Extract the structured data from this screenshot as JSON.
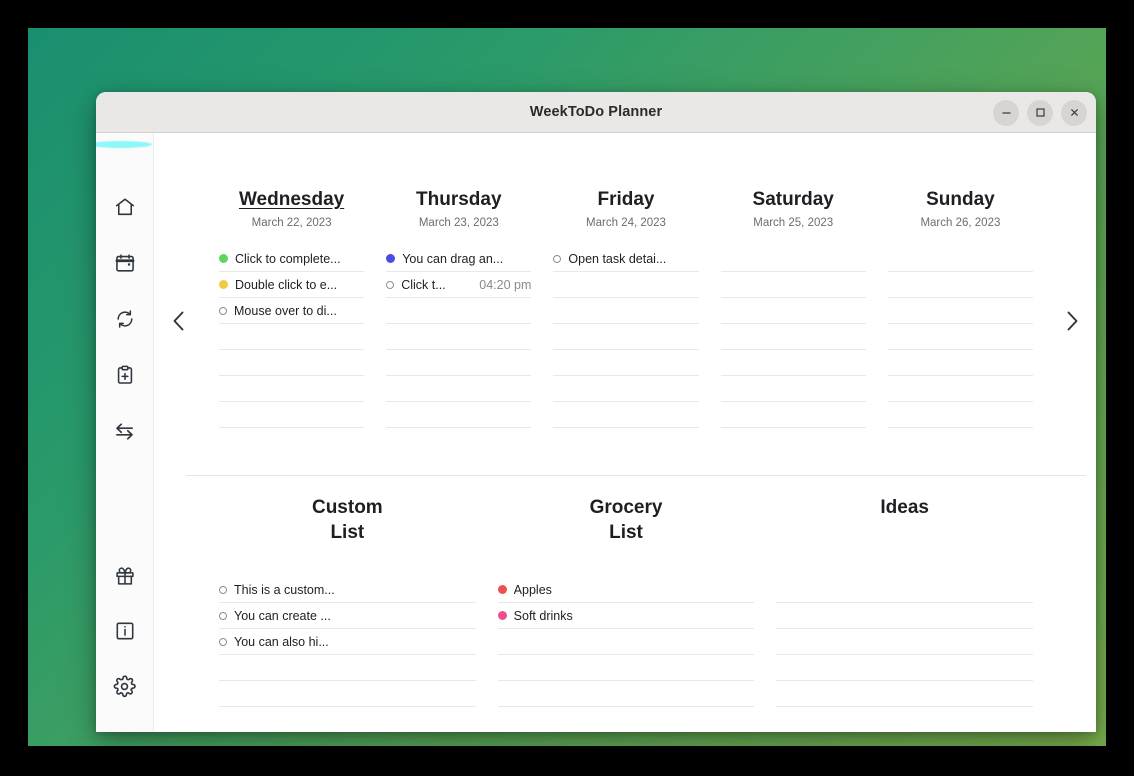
{
  "window": {
    "title": "WeekToDo Planner",
    "controls": [
      {
        "name": "minimize",
        "label": "–"
      },
      {
        "name": "maximize",
        "label": "□"
      },
      {
        "name": "close",
        "label": "×"
      }
    ]
  },
  "sidebar": {
    "top_items": [
      {
        "icon": "home-icon",
        "label": "Home"
      },
      {
        "icon": "calendar-icon",
        "label": "Calendar"
      },
      {
        "icon": "sync-icon",
        "label": "Sync"
      },
      {
        "icon": "clipboard-add-icon",
        "label": "Add Task"
      },
      {
        "icon": "transfer-icon",
        "label": "Move Tasks"
      }
    ],
    "bottom_items": [
      {
        "icon": "gift-icon",
        "label": "What's New"
      },
      {
        "icon": "info-icon",
        "label": "About"
      },
      {
        "icon": "gear-icon",
        "label": "Settings"
      }
    ]
  },
  "nav": {
    "prev_label": "Previous week",
    "next_label": "Next week"
  },
  "week": {
    "days": [
      {
        "name": "Wednesday",
        "date": "March 22, 2023",
        "today": true,
        "tasks": [
          {
            "text": "Click to complete...",
            "bullet": "#5ed65e",
            "time": ""
          },
          {
            "text": "Double click to e...",
            "bullet": "#f2cb3f",
            "time": ""
          },
          {
            "text": "Mouse over to di...",
            "bullet": "",
            "time": ""
          }
        ],
        "empty_rows": 4
      },
      {
        "name": "Thursday",
        "date": "March 23, 2023",
        "today": false,
        "tasks": [
          {
            "text": "You can drag an...",
            "bullet": "#4b4be8",
            "time": ""
          },
          {
            "text": "Click t...",
            "bullet": "",
            "time": "04:20 pm"
          }
        ],
        "empty_rows": 5
      },
      {
        "name": "Friday",
        "date": "March 24, 2023",
        "today": false,
        "tasks": [
          {
            "text": "Open task detai...",
            "bullet": "",
            "time": ""
          }
        ],
        "empty_rows": 6
      },
      {
        "name": "Saturday",
        "date": "March 25, 2023",
        "today": false,
        "tasks": [],
        "empty_rows": 7
      },
      {
        "name": "Sunday",
        "date": "March 26, 2023",
        "today": false,
        "tasks": [],
        "empty_rows": 7
      }
    ]
  },
  "lists": {
    "columns": [
      {
        "title": "Custom\nList",
        "title_line1": "Custom",
        "title_line2": "List",
        "tasks": [
          {
            "text": "This is a custom...",
            "bullet": "",
            "time": ""
          },
          {
            "text": "You can create ...",
            "bullet": "",
            "time": ""
          },
          {
            "text": "You can also hi...",
            "bullet": "",
            "time": ""
          }
        ],
        "empty_rows": 3
      },
      {
        "title": "Grocery\nList",
        "title_line1": "Grocery",
        "title_line2": "List",
        "tasks": [
          {
            "text": "Apples",
            "bullet": "#ee4f4f",
            "time": ""
          },
          {
            "text": "Soft drinks",
            "bullet": "#ef4d8e",
            "time": ""
          }
        ],
        "empty_rows": 4
      },
      {
        "title": "Ideas",
        "title_line1": "Ideas",
        "title_line2": "",
        "tasks": [],
        "empty_rows": 6
      }
    ]
  },
  "colors": {
    "desktop_gradient_start": "#1a8f70",
    "desktop_gradient_end": "#77ad4c",
    "titlebar": "#e9e8e7",
    "sidebar": "#fbfbfb",
    "brand_accent": "#8ef7f7",
    "row_divider": "#e8e8e8",
    "muted_text": "#6d6d6d"
  }
}
